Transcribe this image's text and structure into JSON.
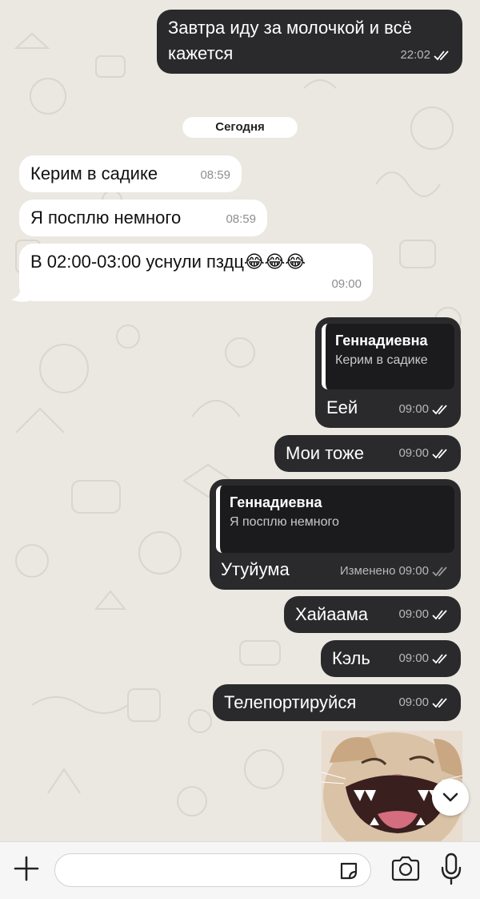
{
  "chat": {
    "date_separator": "Сегодня",
    "messages": [
      {
        "id": "m0",
        "direction": "out",
        "text_lines": [
          "Завтра иду за молочкой и всё",
          "кажется"
        ],
        "time": "22:02",
        "status": "read"
      },
      {
        "id": "m1",
        "direction": "in",
        "text": "Керим в садике",
        "time": "08:59"
      },
      {
        "id": "m2",
        "direction": "in",
        "text": "Я посплю немного",
        "time": "08:59"
      },
      {
        "id": "m3",
        "direction": "in",
        "text": "В 02:00-03:00 уснули пздц😂😂😂",
        "time": "09:00"
      },
      {
        "id": "m4",
        "direction": "out",
        "reply_author": "Геннадиевна",
        "reply_text": "Керим в садике",
        "text": "Еей",
        "time": "09:00",
        "status": "read"
      },
      {
        "id": "m5",
        "direction": "out",
        "text": "Мои тоже",
        "time": "09:00",
        "status": "read"
      },
      {
        "id": "m6",
        "direction": "out",
        "reply_author": "Геннадиевна",
        "reply_text": "Я посплю немного",
        "text": "Утуйума",
        "edited_label": "Изменено",
        "time": "09:00",
        "status": "delivered"
      },
      {
        "id": "m7",
        "direction": "out",
        "text": "Хайаама",
        "time": "09:00",
        "status": "read"
      },
      {
        "id": "m8",
        "direction": "out",
        "text": "Кэль",
        "time": "09:00",
        "status": "read"
      },
      {
        "id": "m9",
        "direction": "out",
        "text": "Телепортируйся",
        "time": "09:00",
        "status": "read"
      },
      {
        "id": "m10",
        "direction": "out",
        "type": "sticker",
        "sticker": "laughing-cat-sticker"
      }
    ]
  },
  "composer": {
    "placeholder": "",
    "icons": [
      "plus-icon",
      "sticker-icon",
      "camera-icon",
      "microphone-icon"
    ]
  },
  "scroll_down_icon": "chevron-down-icon",
  "colors": {
    "outgoing_bubble": "#2a2a2c",
    "incoming_bubble": "#ffffff",
    "chat_background": "#ebe7e1",
    "read_ticks_outgoing": "#ffffff",
    "delivered_ticks": "#9a9a9e"
  }
}
